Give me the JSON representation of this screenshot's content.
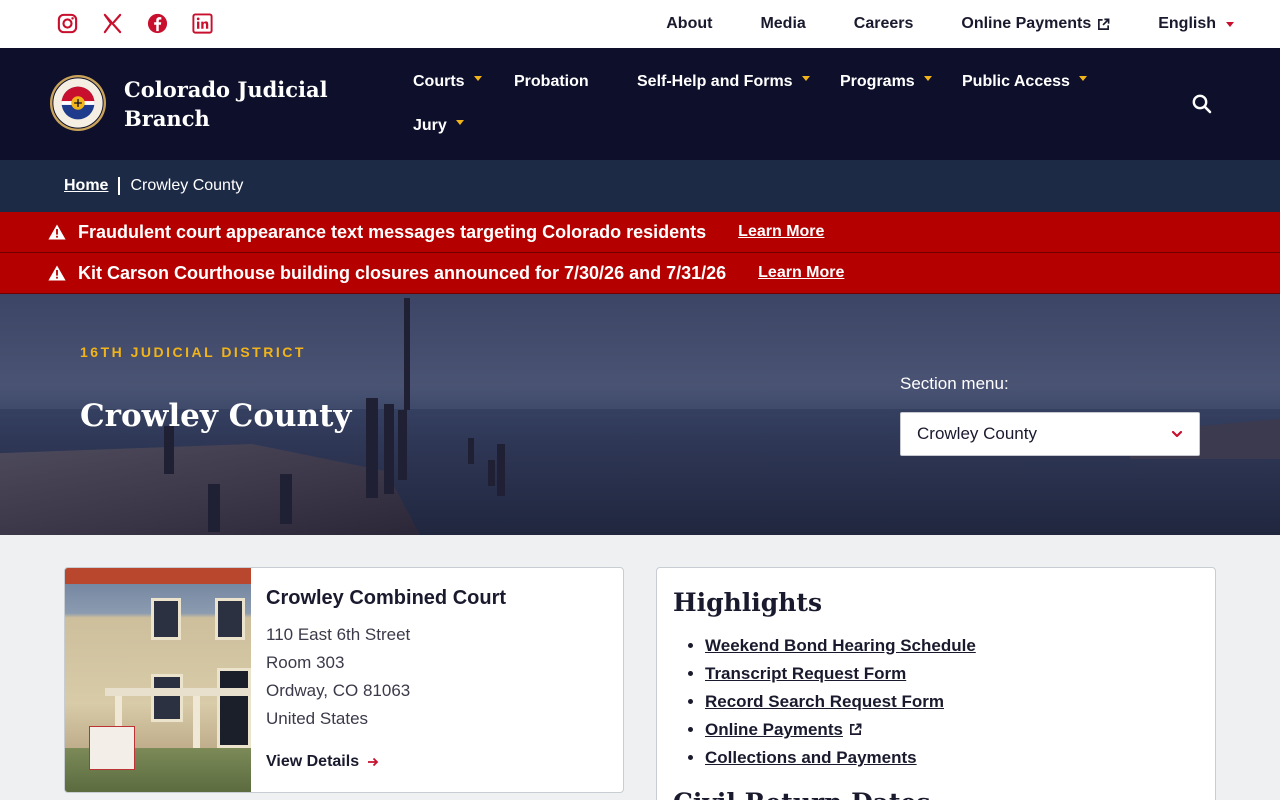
{
  "utility": {
    "social": [
      "instagram-icon",
      "x-icon",
      "facebook-icon",
      "linkedin-icon"
    ],
    "links": [
      "About",
      "Media",
      "Careers",
      "Online Payments"
    ],
    "language": "English"
  },
  "header": {
    "brand": "Colorado Judicial Branch",
    "nav": {
      "courts": "Courts",
      "probation": "Probation",
      "selfhelp": "Self-Help and Forms",
      "programs": "Programs",
      "public_access": "Public Access",
      "jury": "Jury"
    }
  },
  "breadcrumb": {
    "home": "Home",
    "current": "Crowley County"
  },
  "alerts": [
    {
      "message": "Fraudulent court appearance text messages targeting Colorado residents",
      "link": "Learn More"
    },
    {
      "message": "Kit Carson Courthouse building closures announced for 7/30/26 and 7/31/26",
      "link": "Learn More"
    }
  ],
  "hero": {
    "district": "16TH JUDICIAL DISTRICT",
    "title": "Crowley County",
    "section_menu_label": "Section menu:",
    "section_menu_value": "Crowley County"
  },
  "court": {
    "name": "Crowley Combined Court",
    "address": [
      "110 East 6th Street",
      "Room 303",
      "Ordway, CO 81063",
      "United States"
    ],
    "details_link": "View Details"
  },
  "highlights": {
    "title": "Highlights",
    "items": [
      "Weekend Bond Hearing Schedule",
      "Transcript Request Form",
      "Record Search Request Form",
      "Online Payments",
      "Collections and Payments"
    ],
    "next_heading": "Civil Return Dates"
  },
  "colors": {
    "navy": "#0d0f2b",
    "alert_red": "#b50000",
    "accent_gold": "#f2b418",
    "brand_red": "#c8102e"
  }
}
